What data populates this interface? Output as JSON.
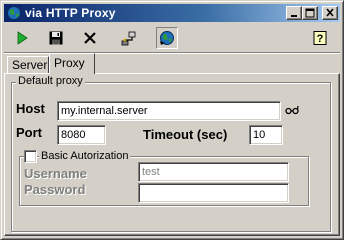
{
  "window": {
    "title": "via HTTP Proxy",
    "controls": [
      "minimize-icon",
      "maximize-icon",
      "close-icon"
    ]
  },
  "toolbar": {
    "buttons": [
      {
        "name": "run-button",
        "icon": "play-icon"
      },
      {
        "name": "save-button",
        "icon": "floppy-disk-icon"
      },
      {
        "name": "delete-button",
        "icon": "x-icon"
      },
      {
        "name": "connect-button",
        "icon": "network-plug-icon"
      },
      {
        "name": "globe-button",
        "icon": "globe-icon",
        "pressed": true
      },
      {
        "name": "help-button",
        "icon": "help-icon"
      }
    ]
  },
  "tabs": [
    {
      "label": "Server",
      "active": false
    },
    {
      "label": "Proxy",
      "active": true
    }
  ],
  "proxy": {
    "group_caption": "Default proxy",
    "host_label": "Host",
    "host_value": "my.internal.server",
    "port_label": "Port",
    "port_value": "8080",
    "timeout_label": "Timeout (sec)",
    "timeout_value": "10",
    "auth": {
      "checkbox_label": "Basic Autorization",
      "checked": false,
      "username_label": "Username",
      "username_value": "test",
      "password_label": "Password",
      "password_value": ""
    }
  },
  "colors": {
    "titlebar_start": "#0a246a",
    "titlebar_end": "#a6caf0",
    "face": "#d4d0c8"
  }
}
